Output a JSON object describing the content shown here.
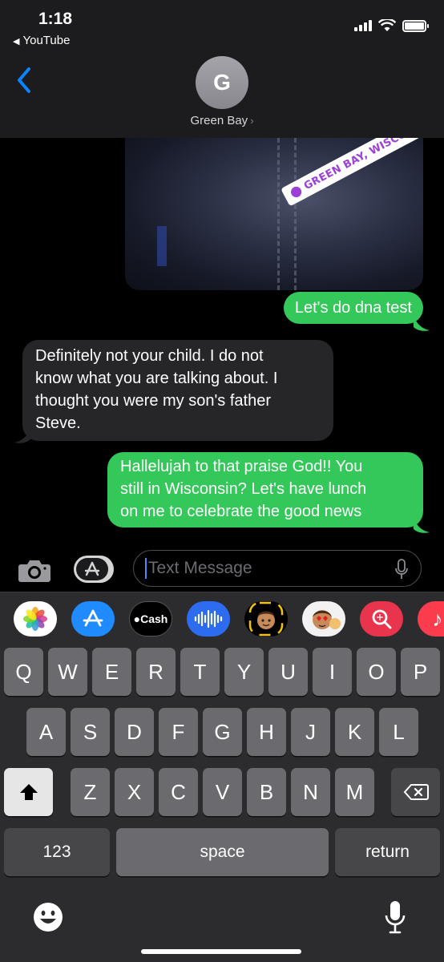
{
  "status_bar": {
    "time": "1:18",
    "back_app": "YouTube",
    "icons": [
      "signal-icon",
      "wifi-icon",
      "battery-icon"
    ]
  },
  "header": {
    "avatar_initial": "G",
    "contact_name": "Green Bay",
    "back_icon": "chevron-left-icon"
  },
  "messages": {
    "photo_sticker": "GREEN BAY, WISCONSIN",
    "sent_1": "Let's do dna test",
    "received_1_lines": [
      "Definitely not your child.  I do not",
      "know what you are talking about.  I",
      "thought you were my son's father",
      "Steve."
    ],
    "sent_2_lines": [
      "Hallelujah to that praise God!! You",
      "still in Wisconsin? Let's have lunch",
      "on me to celebrate the good news"
    ]
  },
  "input": {
    "placeholder": "Text Message",
    "camera_icon": "camera-icon",
    "apps_icon": "app-store-icon",
    "mic_icon": "microphone-icon"
  },
  "app_drawer": {
    "apps": [
      "Photos",
      "App Store",
      "Cash",
      "Audio",
      "Memoji",
      "Memoji Stickers",
      "Search",
      "Music"
    ],
    "cash_label": "Cash"
  },
  "keyboard": {
    "row1": [
      "Q",
      "W",
      "E",
      "R",
      "T",
      "Y",
      "U",
      "I",
      "O",
      "P"
    ],
    "row2": [
      "A",
      "S",
      "D",
      "F",
      "G",
      "H",
      "J",
      "K",
      "L"
    ],
    "row3": [
      "Z",
      "X",
      "C",
      "V",
      "B",
      "N",
      "M"
    ],
    "numbers_label": "123",
    "space_label": "space",
    "return_label": "return"
  },
  "colors": {
    "sent_bubble": "#34c759",
    "received_bubble": "#262629",
    "accent": "#0a84ff"
  }
}
